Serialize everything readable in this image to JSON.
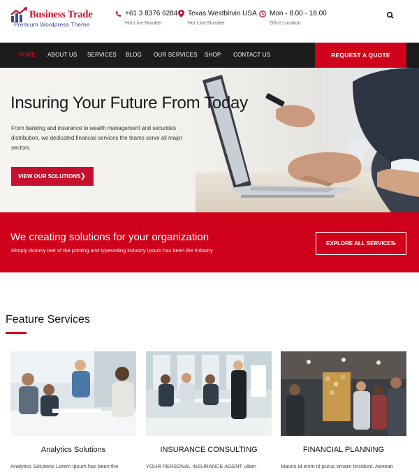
{
  "brand": {
    "title": "Business Trade",
    "tagline": "Premium Wordpress Theme",
    "colors": {
      "accent": "#d0021b",
      "nav_bg": "#1c1c1c",
      "tagline": "#3b4d8c"
    }
  },
  "contacts": [
    {
      "icon": "phone-icon",
      "value": "+61 3 8376 6284",
      "label": "Hot Line Number"
    },
    {
      "icon": "map-pin-icon",
      "value": "Texas Westblrvin USA",
      "label": "Hot Line Number"
    },
    {
      "icon": "clock-icon",
      "value": "Mon - 8.00 - 18.00",
      "label": "Ofice Location"
    }
  ],
  "nav": {
    "items": [
      {
        "label": "HOME",
        "active": true
      },
      {
        "label": "ABOUT US"
      },
      {
        "label": "SERVICES"
      },
      {
        "label": "BLOG"
      },
      {
        "label": "OUR SERVICES"
      },
      {
        "label": "SHOP"
      },
      {
        "label": "CONTACT US"
      }
    ],
    "quote_label": "REQUEST A QUOTE"
  },
  "hero": {
    "title": "Insuring Your Future From Today",
    "text": "From banking and insurance to wealth management and securities distribution, we dedicated financial services the teams serve all major sectors.",
    "button_label": "VIEW OUR SOLUTIONS"
  },
  "banner": {
    "title": "We creating solutions for your organization",
    "subtitle": "Rimply dummy text of the printing and typesetting industry Ipsum has been the industry",
    "button_label": "EXPLORE ALL SERVICES"
  },
  "features": {
    "title": "Feature Services",
    "cards": [
      {
        "title": "Analytics Solutions",
        "text": "Analytics Solutions Lorem Ipsum has been the"
      },
      {
        "title": "INSURANCE CONSULTING",
        "text": "YOUR PERSONAL INSURANCE AGENT ullam"
      },
      {
        "title": "FINANCIAL PLANNING",
        "text": "Mauris id enim id purus ornare tincidunt. Aenean"
      }
    ]
  }
}
